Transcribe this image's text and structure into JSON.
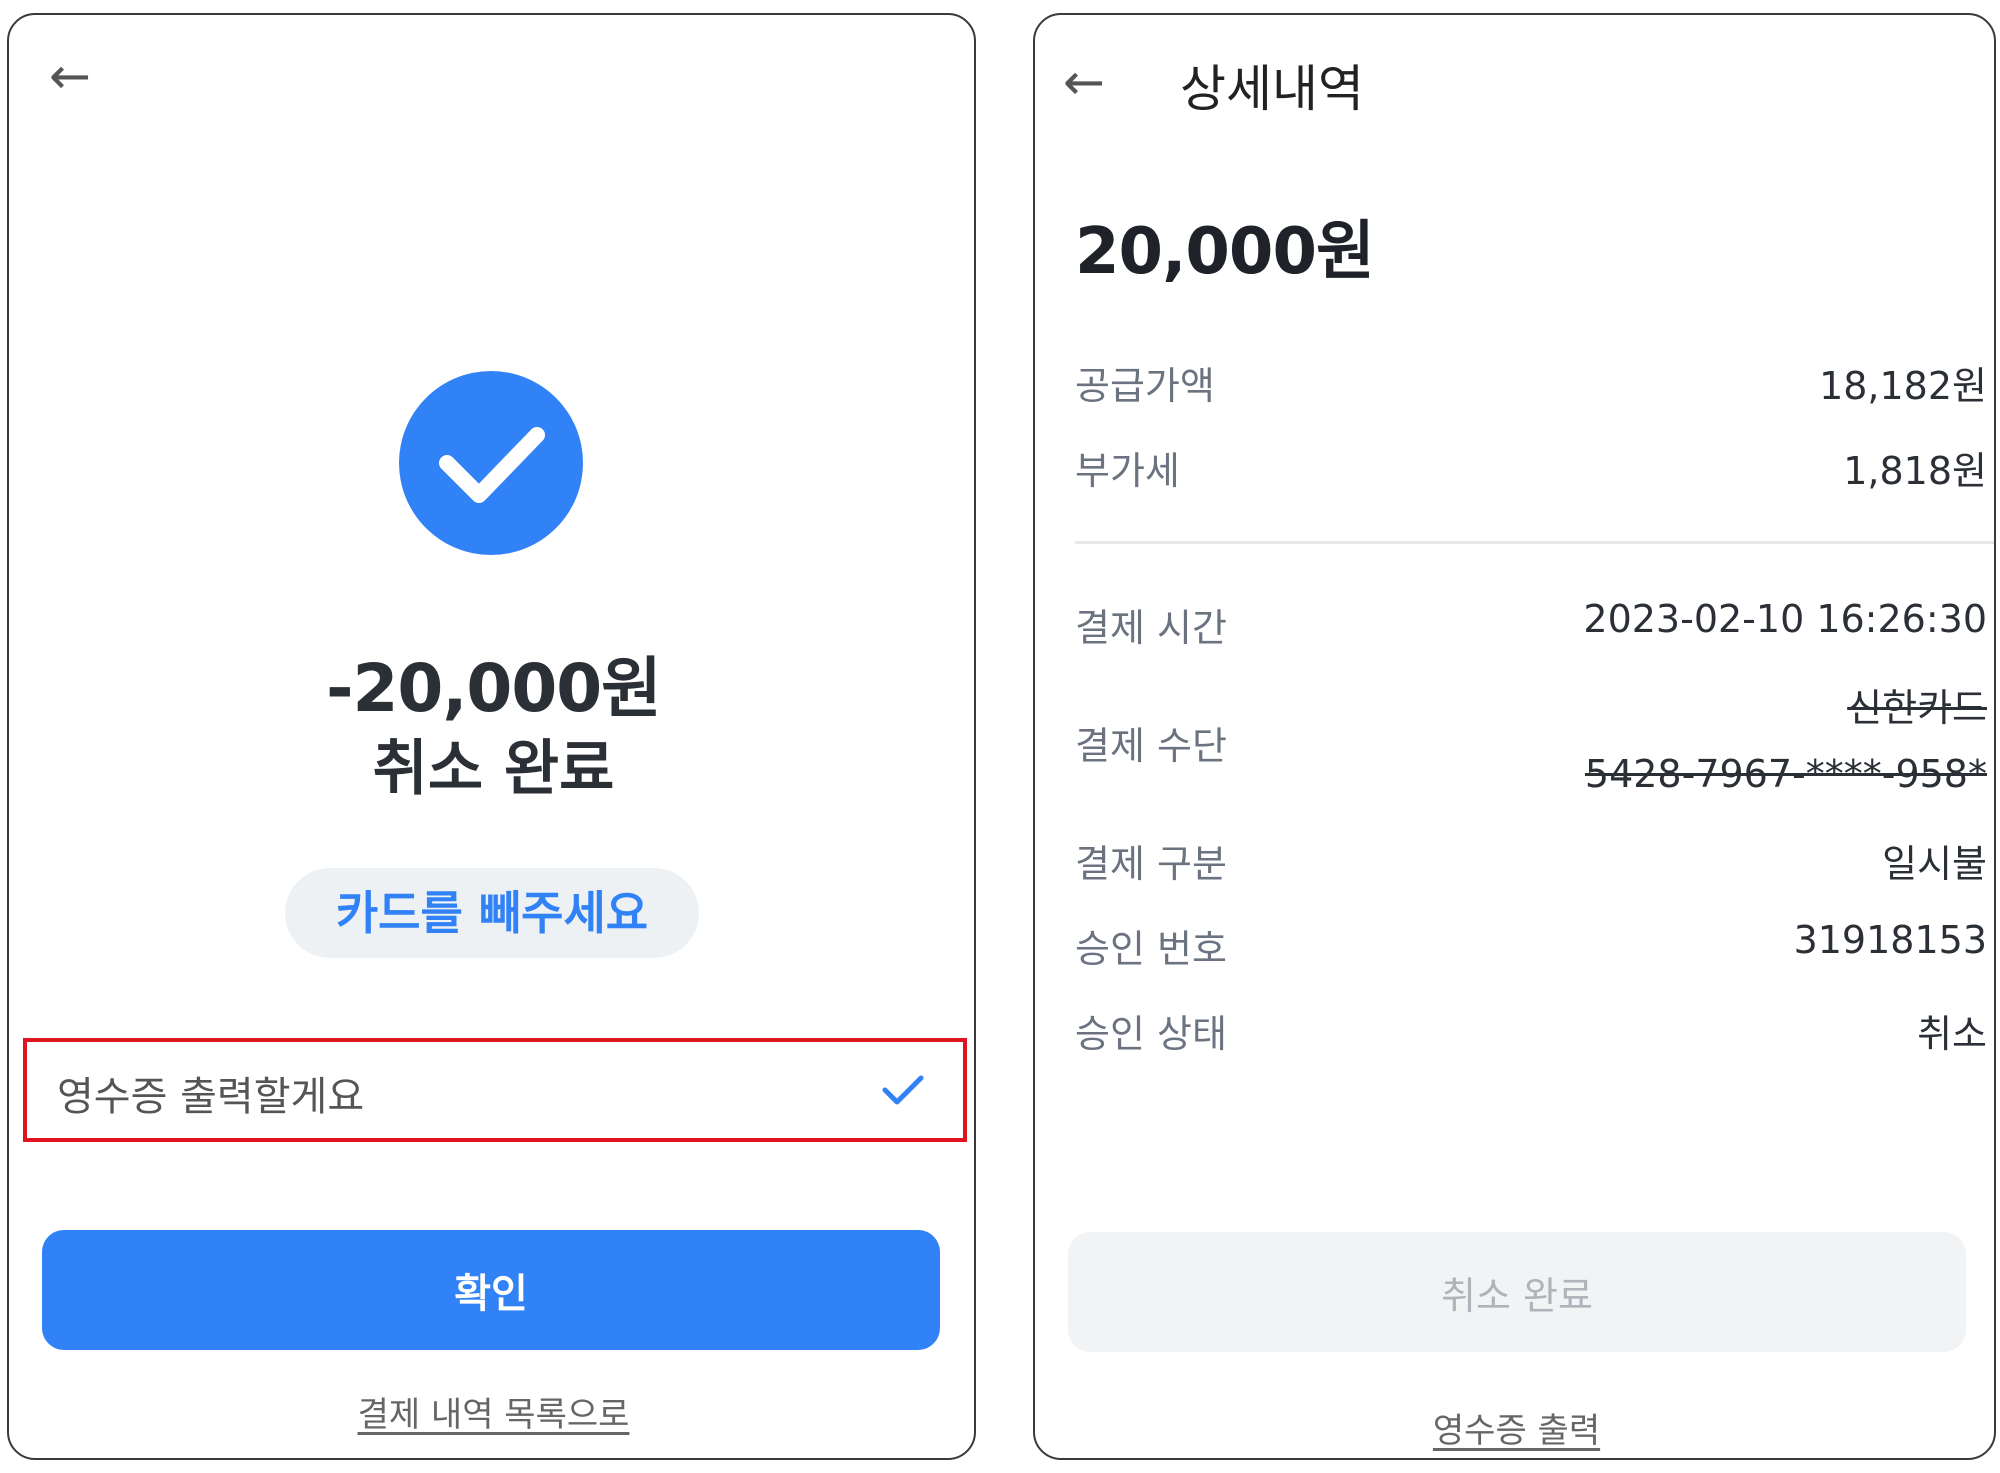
{
  "left": {
    "amount": "-20,000원",
    "status_title": "취소 완료",
    "instruction_pill": "카드를 빼주세요",
    "receipt_option": "영수증 출력할게요",
    "confirm_button": "확인",
    "back_to_list_link": "결제 내역 목록으로"
  },
  "right": {
    "title": "상세내역",
    "amount": "20,000원",
    "supply_price": {
      "label": "공급가액",
      "value": "18,182원"
    },
    "vat": {
      "label": "부가세",
      "value": "1,818원"
    },
    "payment_time": {
      "label": "결제 시간",
      "value": "2023-02-10 16:26:30"
    },
    "payment_method": {
      "label": "결제 수단",
      "card_name": "신한카드",
      "card_number": "5428-7967-****-958*"
    },
    "payment_type": {
      "label": "결제 구분",
      "value": "일시불"
    },
    "approval_number": {
      "label": "승인 번호",
      "value": "31918153"
    },
    "approval_status": {
      "label": "승인 상태",
      "value": "취소"
    },
    "status_button": "취소 완료",
    "receipt_link": "영수증 출력"
  },
  "colors": {
    "accent": "#3182f6",
    "highlight_border": "#e0141e"
  },
  "icons": {
    "back": "arrow-left-icon",
    "success": "check-circle-icon",
    "selected": "check-icon"
  }
}
